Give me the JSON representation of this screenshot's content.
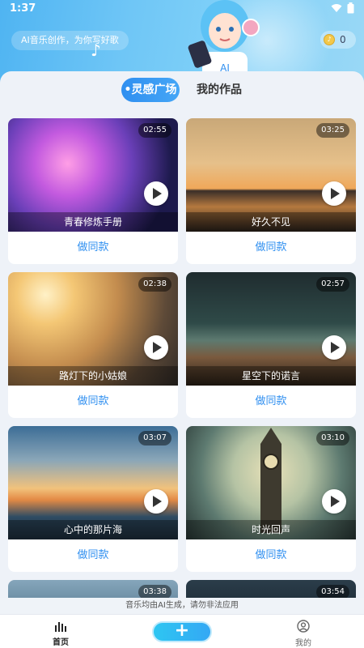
{
  "status": {
    "time": "1:37"
  },
  "header": {
    "slogan": "AI音乐创作，为你写好歌",
    "coins": "0",
    "accent": "#2f8ff0"
  },
  "tabs": [
    {
      "label": "•灵感广场",
      "active": true
    },
    {
      "label": "我的作品",
      "active": false
    }
  ],
  "action_label": "做同款",
  "cards": [
    {
      "title": "青春修炼手册",
      "duration": "02:55"
    },
    {
      "title": "好久不见",
      "duration": "03:25"
    },
    {
      "title": "路灯下的小姑娘",
      "duration": "02:38"
    },
    {
      "title": "星空下的诺言",
      "duration": "02:57"
    },
    {
      "title": "心中的那片海",
      "duration": "03:07"
    },
    {
      "title": "时光回声",
      "duration": "03:10"
    },
    {
      "title": "",
      "duration": "03:38"
    },
    {
      "title": "",
      "duration": "03:54"
    }
  ],
  "disclaimer": "音乐均由AI生成，请勿非法应用",
  "bottom_nav": {
    "home": "首页",
    "create": "+",
    "mine": "我的"
  }
}
